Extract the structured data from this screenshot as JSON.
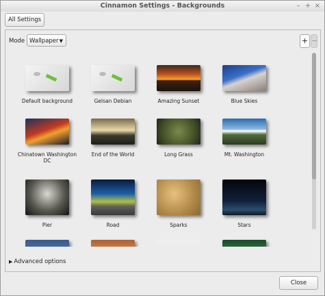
{
  "window": {
    "title": "Cinnamon Settings - Backgrounds",
    "minimize": "–",
    "maximize": "+",
    "close": "×"
  },
  "toolbar": {
    "all_settings_label": "All Settings"
  },
  "mode": {
    "label": "Mode",
    "selected": "Wallpaper",
    "arrow": "▼"
  },
  "buttons": {
    "add": "+",
    "remove": "−",
    "close_label": "Close"
  },
  "advanced": {
    "label": "Advanced options",
    "arrow": "▶"
  },
  "gallery": {
    "items": [
      {
        "caption": "Default background",
        "icon": "default"
      },
      {
        "caption": "Gelsan Debian",
        "icon": "default"
      },
      {
        "caption": "Amazing Sunset",
        "icon": "sunset"
      },
      {
        "caption": "Blue Skies",
        "icon": "blue"
      },
      {
        "caption": "Chinatown Washington DC",
        "icon": "china"
      },
      {
        "caption": "End of the World",
        "icon": "end"
      },
      {
        "caption": "Long Grass",
        "icon": "grass"
      },
      {
        "caption": "Mt. Washington",
        "icon": "mt"
      },
      {
        "caption": "Pier",
        "icon": "pier"
      },
      {
        "caption": "Road",
        "icon": "road"
      },
      {
        "caption": "Sparks",
        "icon": "sparks"
      },
      {
        "caption": "Stars",
        "icon": "stars"
      },
      {
        "caption": "",
        "icon": "r5a"
      },
      {
        "caption": "",
        "icon": "r5b"
      },
      {
        "caption": "",
        "icon": "r5c"
      },
      {
        "caption": "",
        "icon": "r5d"
      }
    ]
  }
}
